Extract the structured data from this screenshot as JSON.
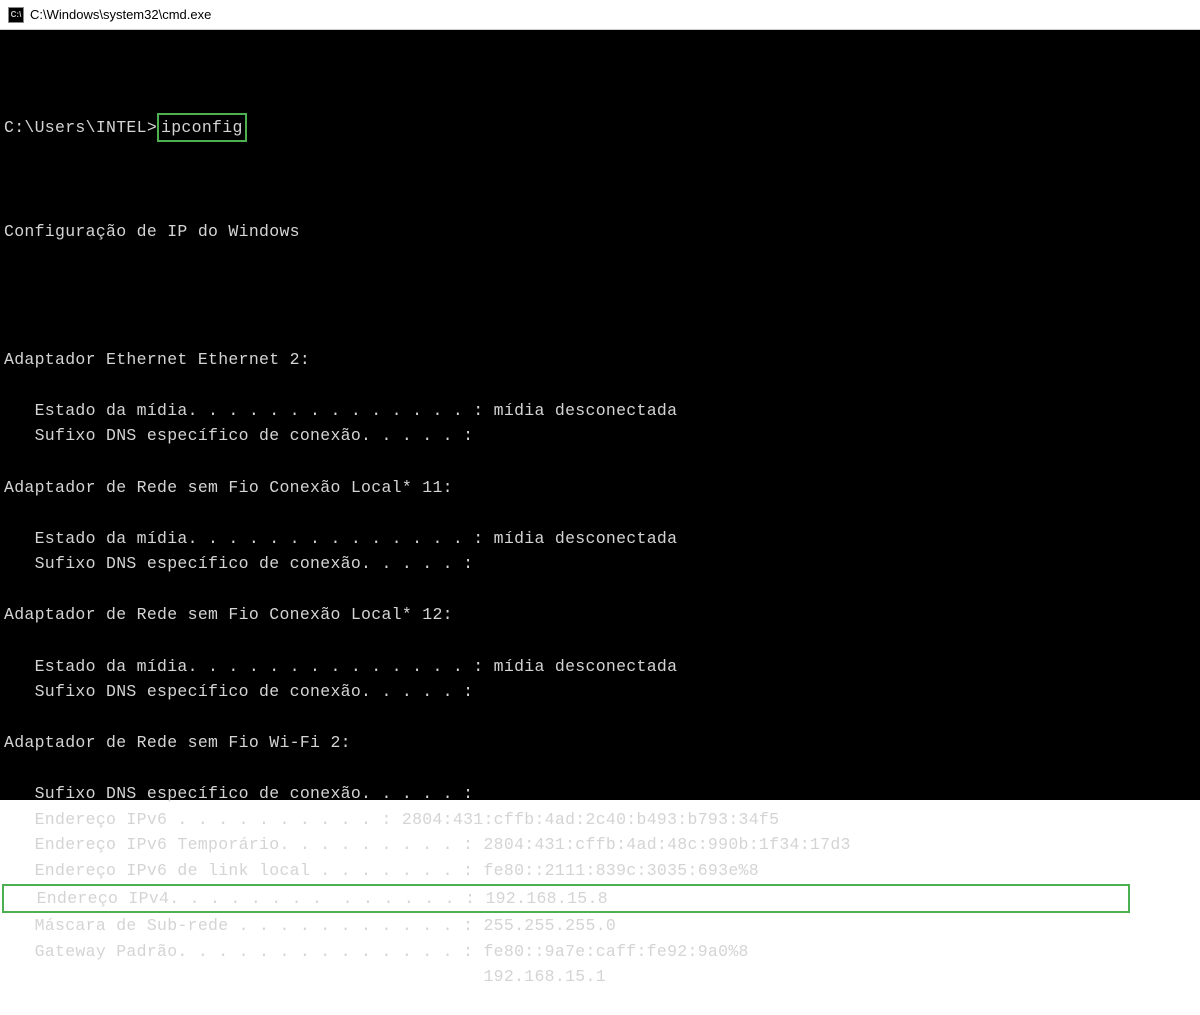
{
  "titlebar": {
    "icon_label": "C:\\",
    "title": "C:\\Windows\\system32\\cmd.exe"
  },
  "terminal": {
    "prompt": "C:\\Users\\INTEL>",
    "command": "ipconfig",
    "header": "Configuração de IP do Windows",
    "adapters": [
      {
        "name": "Adaptador Ethernet Ethernet 2:",
        "lines": [
          "   Estado da mídia. . . . . . . . . . . . . . : mídia desconectada",
          "   Sufixo DNS específico de conexão. . . . . :"
        ]
      },
      {
        "name": "Adaptador de Rede sem Fio Conexão Local* 11:",
        "lines": [
          "   Estado da mídia. . . . . . . . . . . . . . : mídia desconectada",
          "   Sufixo DNS específico de conexão. . . . . :"
        ]
      },
      {
        "name": "Adaptador de Rede sem Fio Conexão Local* 12:",
        "lines": [
          "   Estado da mídia. . . . . . . . . . . . . . : mídia desconectada",
          "   Sufixo DNS específico de conexão. . . . . :"
        ]
      },
      {
        "name": "Adaptador de Rede sem Fio Wi-Fi 2:",
        "lines": [
          "   Sufixo DNS específico de conexão. . . . . :",
          "   Endereço IPv6 . . . . . . . . . . : 2804:431:cffb:4ad:2c40:b493:b793:34f5",
          "   Endereço IPv6 Temporário. . . . . . . . . : 2804:431:cffb:4ad:48c:990b:1f34:17d3",
          "   Endereço IPv6 de link local . . . . . . . : fe80::2111:839c:3035:693e%8",
          "   Endereço IPv4. . . . . . . .  . . . . . . : 192.168.15.8",
          "   Máscara de Sub-rede . . . . . . . . . . . : 255.255.255.0",
          "   Gateway Padrão. . . . . . . . . . . . . . : fe80::9a7e:caff:fe92:9a0%8",
          "                                               192.168.15.1"
        ],
        "highlight_index": 4
      }
    ]
  }
}
